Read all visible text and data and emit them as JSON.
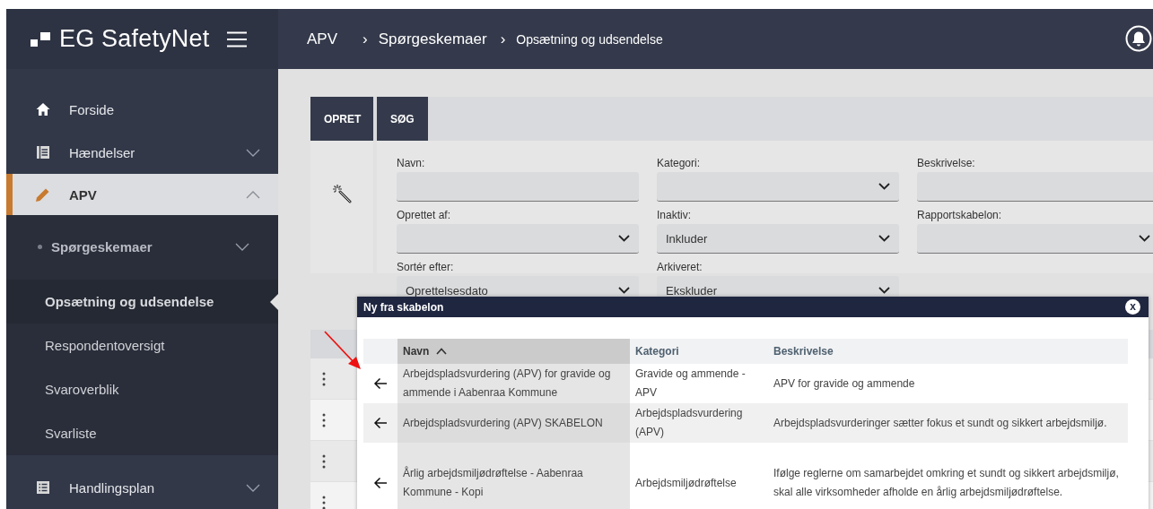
{
  "logo": {
    "text": "EG SafetyNet"
  },
  "breadcrumb": [
    {
      "label": "APV"
    },
    {
      "separator": "›",
      "label": "Spørgeskemaer"
    },
    {
      "separator": "›",
      "label": "Opsætning og udsendelse"
    }
  ],
  "sidebar": {
    "items": [
      {
        "kind": "home",
        "label": "Forside",
        "selected": false
      },
      {
        "kind": "book",
        "label": "Hændelser",
        "selected": false,
        "expanded": false
      },
      {
        "kind": "pencil",
        "label": "APV",
        "selected": true,
        "expanded": true,
        "children": [
          {
            "kind": "group",
            "label": "Spørgeskemaer",
            "selected": false,
            "expanded": false
          },
          {
            "kind": "link",
            "label": "Opsætning og udsendelse",
            "selected": true
          },
          {
            "kind": "link",
            "label": "Respondentoversigt",
            "selected": false
          },
          {
            "kind": "link",
            "label": "Svaroverblik",
            "selected": false
          },
          {
            "kind": "link",
            "label": "Svarliste",
            "selected": false
          }
        ]
      },
      {
        "kind": "list",
        "label": "Handlingsplan",
        "selected": false,
        "expanded": false
      }
    ]
  },
  "tabs": [
    {
      "label": "OPRET"
    },
    {
      "label": "SØG"
    }
  ],
  "form": {
    "fields": [
      {
        "label": "Navn:",
        "kind": "text"
      },
      {
        "label": "Kategori:",
        "kind": "select"
      },
      {
        "label": "Beskrivelse:",
        "kind": "text"
      },
      {
        "label": "Oprettet af:",
        "kind": "select"
      },
      {
        "label": "Inaktiv:",
        "kind": "select",
        "value": "Inkluder"
      },
      {
        "label": "Rapportskabelon:",
        "kind": "select"
      },
      {
        "label": "Sortér efter:",
        "kind": "select",
        "value": "Oprettelsesdato"
      },
      {
        "label": "Arkiveret:",
        "kind": "select",
        "value": "Ekskluder"
      }
    ]
  },
  "background_table": {
    "rows": [
      {
        "kind": "row"
      },
      {
        "kind": "row"
      },
      {
        "kind": "row"
      },
      {
        "kind": "row"
      }
    ]
  },
  "modal": {
    "title": "Ny fra skabelon",
    "close": "x",
    "columns": [
      {
        "label": "Navn",
        "sorted": true
      },
      {
        "label": "Kategori"
      },
      {
        "label": "Beskrivelse"
      }
    ],
    "rows": [
      {
        "navn": "Arbejdspladsvurdering (APV) for gravide og ammende i Aabenraa Kommune",
        "kategori": "Gravide og ammende - APV",
        "beskrivelse": "APV for gravide og ammende"
      },
      {
        "navn": "Arbejdspladsvurdering (APV) SKABELON",
        "kategori": "Arbejdspladsvurdering (APV)",
        "beskrivelse": "Arbejdspladsvurderinger sætter fokus et sundt og sikkert arbejdsmiljø."
      },
      {
        "navn": "Årlig arbejdsmiljødrøftelse - Aabenraa Kommune - Kopi",
        "kategori": "Arbejdsmiljødrøftelse",
        "beskrivelse": "Ifølge reglerne om samarbejdet omkring et sundt og sikkert arbejdsmiljø, skal alle virksomheder afholde en årlig arbejdsmiljødrøftelse."
      }
    ]
  }
}
